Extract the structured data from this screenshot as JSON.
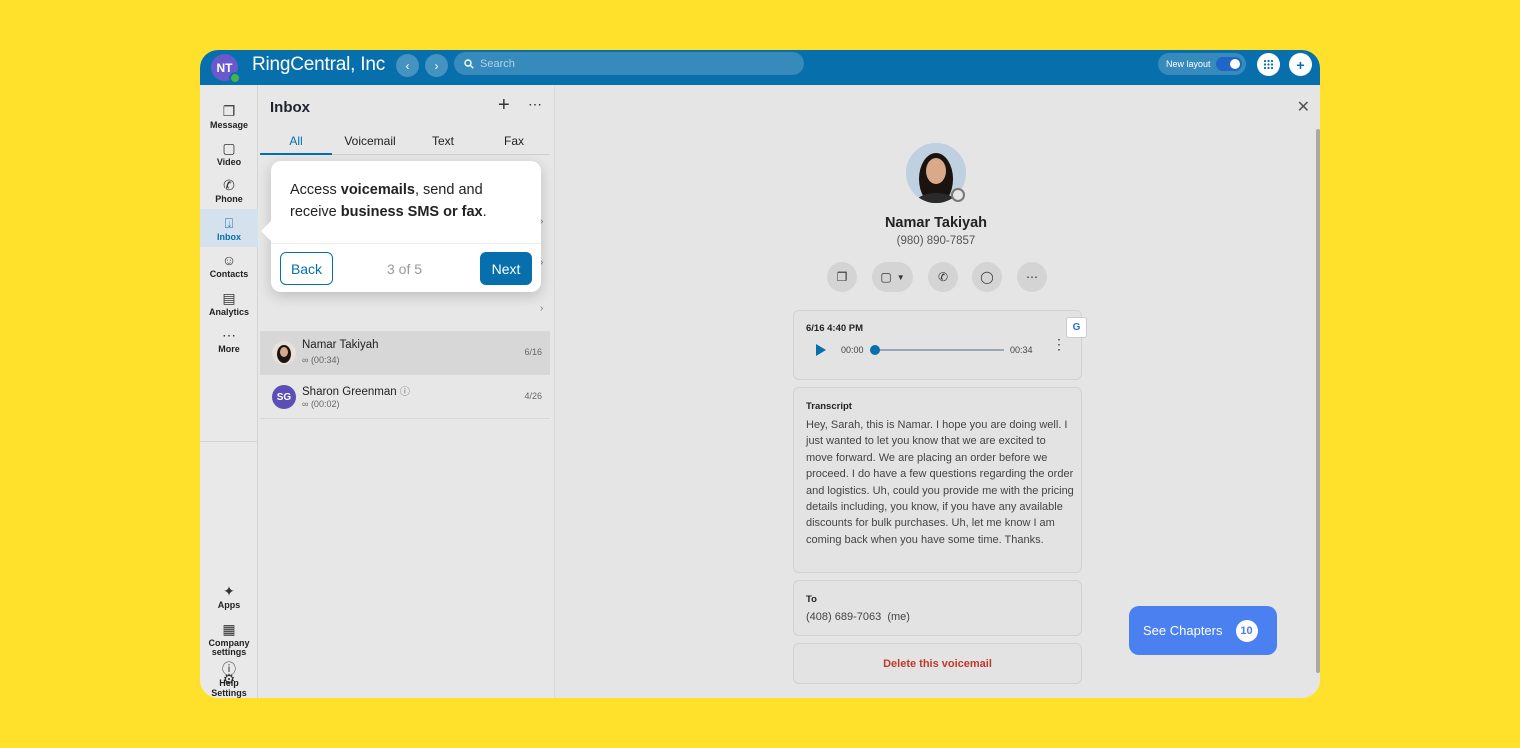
{
  "topbar": {
    "user_initials": "NT",
    "brand": "RingCentral, Inc",
    "search_placeholder": "Search",
    "new_layout_label": "New layout"
  },
  "rail": {
    "items": [
      {
        "label": "Message",
        "icon": "message-icon"
      },
      {
        "label": "Video",
        "icon": "video-icon"
      },
      {
        "label": "Phone",
        "icon": "phone-icon"
      },
      {
        "label": "Inbox",
        "icon": "inbox-icon",
        "active": true
      },
      {
        "label": "Contacts",
        "icon": "contacts-icon"
      },
      {
        "label": "Analytics",
        "icon": "analytics-icon"
      },
      {
        "label": "More",
        "icon": "more-icon"
      }
    ],
    "bottom": [
      {
        "label": "Apps",
        "icon": "puzzle-icon"
      },
      {
        "label": "Company settings",
        "icon": "building-icon"
      },
      {
        "label": "Settings",
        "icon": "gear-icon"
      },
      {
        "label": "Help",
        "icon": "help-icon"
      }
    ]
  },
  "inbox": {
    "title": "Inbox",
    "tabs": [
      "All",
      "Voicemail",
      "Text",
      "Fax"
    ],
    "active_tab": "All",
    "rows": [
      {
        "name": "Namar Takiyah",
        "duration": "(00:34)",
        "date": "6/16",
        "selected": true
      },
      {
        "name": "Sharon Greenman",
        "initials": "SG",
        "duration": "(00:02)",
        "date": "4/26"
      }
    ]
  },
  "tour": {
    "text_prefix": "Access ",
    "bold_1": "voicemails",
    "text_mid": ", send and receive ",
    "bold_2": "business SMS or fax",
    "text_suffix": ".",
    "back_label": "Back",
    "progress": "3 of 5",
    "next_label": "Next"
  },
  "contact": {
    "name": "Namar Takiyah",
    "phone": "(980) 890-7857"
  },
  "voicemail": {
    "datetime": "6/16 4:40 PM",
    "time_start": "00:00",
    "time_end": "00:34",
    "progress": 0
  },
  "transcript": {
    "label": "Transcript",
    "text": "Hey, Sarah, this is Namar. I hope you are doing well. I just wanted to let you know that we are excited to move forward. We are placing an order before we proceed. I do have a few questions regarding the order and logistics. Uh, could you provide me with the pricing details including, you know, if you have any available discounts for bulk purchases. Uh, let me know I am coming back when you have some time. Thanks."
  },
  "to": {
    "label": "To",
    "value": "(408) 689-7063  (me)"
  },
  "delete_label": "Delete this voicemail",
  "chapters": {
    "label": "See Chapters",
    "count": "10"
  },
  "colors": {
    "background": "#FFE02A",
    "brand_blue": "#066FAC",
    "chapters_blue": "#4B80F0",
    "delete_red": "#C0392B"
  }
}
